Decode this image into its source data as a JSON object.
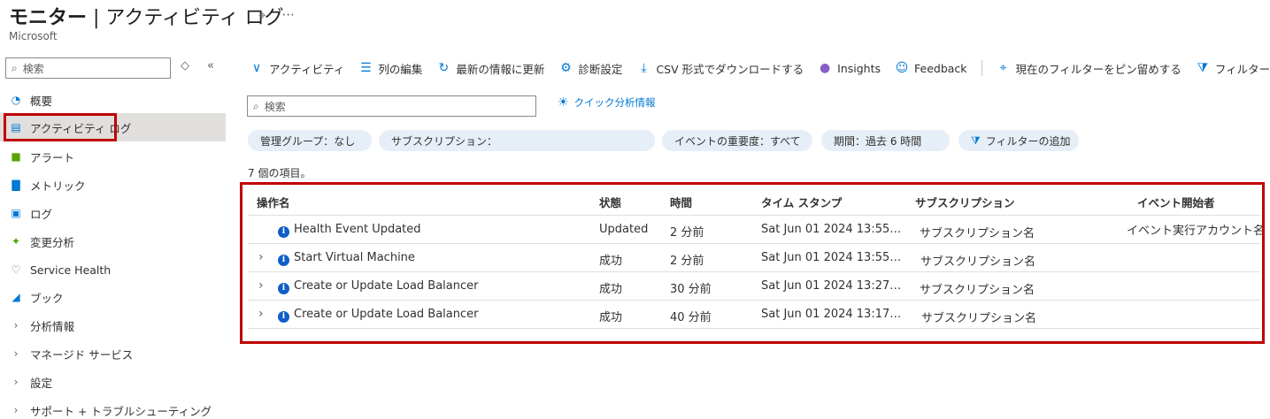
{
  "header": {
    "title_bold": "モニター",
    "title_rest": " | アクティビティ ログ",
    "subtitle": "Microsoft",
    "pin_icon": "pin-icon",
    "more_icon": "ellipsis-icon"
  },
  "sidebar": {
    "search_placeholder": "検索",
    "items": [
      {
        "label": "概要",
        "icon": "overview-icon"
      },
      {
        "label": "アクティビティ ログ",
        "icon": "activity-log-icon"
      },
      {
        "label": "アラート",
        "icon": "alert-icon"
      },
      {
        "label": "メトリック",
        "icon": "metrics-icon"
      },
      {
        "label": "ログ",
        "icon": "logs-icon"
      },
      {
        "label": "変更分析",
        "icon": "change-analysis-icon"
      },
      {
        "label": "Service Health",
        "icon": "heart-icon"
      },
      {
        "label": "ブック",
        "icon": "workbook-icon"
      },
      {
        "label": "分析情報",
        "icon": "chevron-right-icon"
      },
      {
        "label": "マネージド サービス",
        "icon": "chevron-right-icon"
      },
      {
        "label": "設定",
        "icon": "chevron-right-icon"
      },
      {
        "label": "サポート + トラブルシューティング",
        "icon": "chevron-right-icon"
      }
    ]
  },
  "toolbar": {
    "activity": "アクティビティ",
    "edit_columns": "列の編集",
    "refresh": "最新の情報に更新",
    "diagnostics": "診断設定",
    "download_csv": "CSV 形式でダウンロードする",
    "insights": "Insights",
    "feedback": "Feedback",
    "pin_filter": "現在のフィルターをピン留めする",
    "reset_filter": "フィルターのリセット"
  },
  "main": {
    "search_placeholder": "検索",
    "quick_insights": "クイック分析情報",
    "filters": {
      "mgmt_group": "管理グループ：なし",
      "subscription": "サブスクリプション：",
      "severity": "イベントの重要度：すべて",
      "period": "期間：過去 6 時間",
      "add_filter": "フィルターの追加"
    },
    "item_count": "7 個の項目。"
  },
  "table": {
    "headers": [
      "操作名",
      "状態",
      "時間",
      "タイム スタンプ",
      "サブスクリプション",
      "イベント開始者"
    ],
    "rows": [
      {
        "name": "Health Event Updated",
        "status": "Updated",
        "time": "2 分前",
        "timestamp": "Sat Jun 01 2024 13:55…",
        "subscription": "サブスクリプション名",
        "initiator": "イベント実行アカウント名"
      },
      {
        "name": "Start Virtual Machine",
        "status": "成功",
        "time": "2 分前",
        "timestamp": "Sat Jun 01 2024 13:55…",
        "subscription": "サブスクリプション名",
        "initiator": ""
      },
      {
        "name": "Create or Update Load Balancer",
        "status": "成功",
        "time": "30 分前",
        "timestamp": "Sat Jun 01 2024 13:27…",
        "subscription": "サブスクリプション名",
        "initiator": ""
      },
      {
        "name": "Create or Update Load Balancer",
        "status": "成功",
        "time": "40 分前",
        "timestamp": "Sat Jun 01 2024 13:17…",
        "subscription": "サブスクリプション名",
        "initiator": ""
      }
    ]
  },
  "colors": {
    "accent": "#0078d4",
    "highlight": "#c00000",
    "pill": "#e6eef7"
  }
}
